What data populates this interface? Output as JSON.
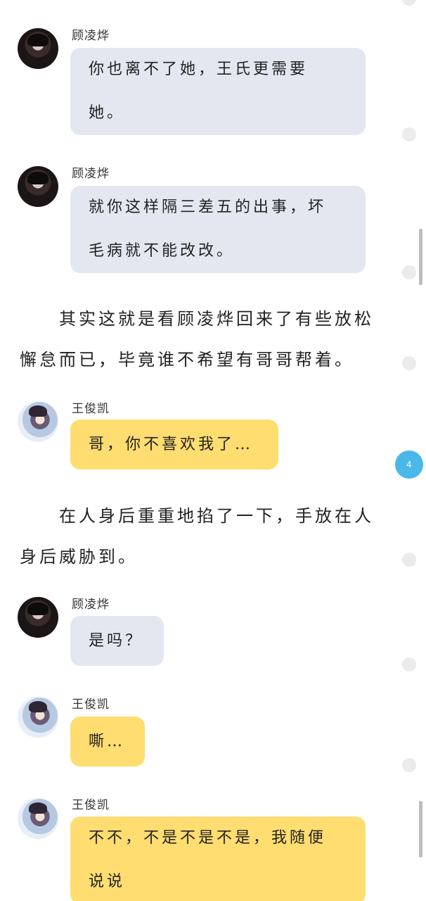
{
  "messages": [
    {
      "speaker": "顾凌烨",
      "lines": [
        "你也离不了她，王氏更需要",
        "她。"
      ]
    },
    {
      "speaker": "顾凌烨",
      "lines": [
        "就你这样隔三差五的出事，坏",
        "毛病就不能改改。"
      ]
    },
    {
      "speaker": "王俊凯",
      "lines": [
        "哥，你不喜欢我了…"
      ]
    },
    {
      "speaker": "顾凌烨",
      "lines": [
        "是吗？"
      ]
    },
    {
      "speaker": "王俊凯",
      "lines": [
        "嘶…"
      ]
    },
    {
      "speaker": "王俊凯",
      "lines": [
        "不不，不是不是不是，我随便",
        "说说"
      ]
    }
  ],
  "narrations": [
    "其实这就是看顾凌烨回来了有些放松懈怠而已，毕竟谁不希望有哥哥帮着。",
    "在人身后重重地掐了一下，手放在人身后威胁到。"
  ],
  "comment_badge": "4",
  "colors": {
    "bubble_grey": "#e3e8f0",
    "bubble_yellow": "#ffdd70",
    "badge": "#4ab8e8"
  }
}
